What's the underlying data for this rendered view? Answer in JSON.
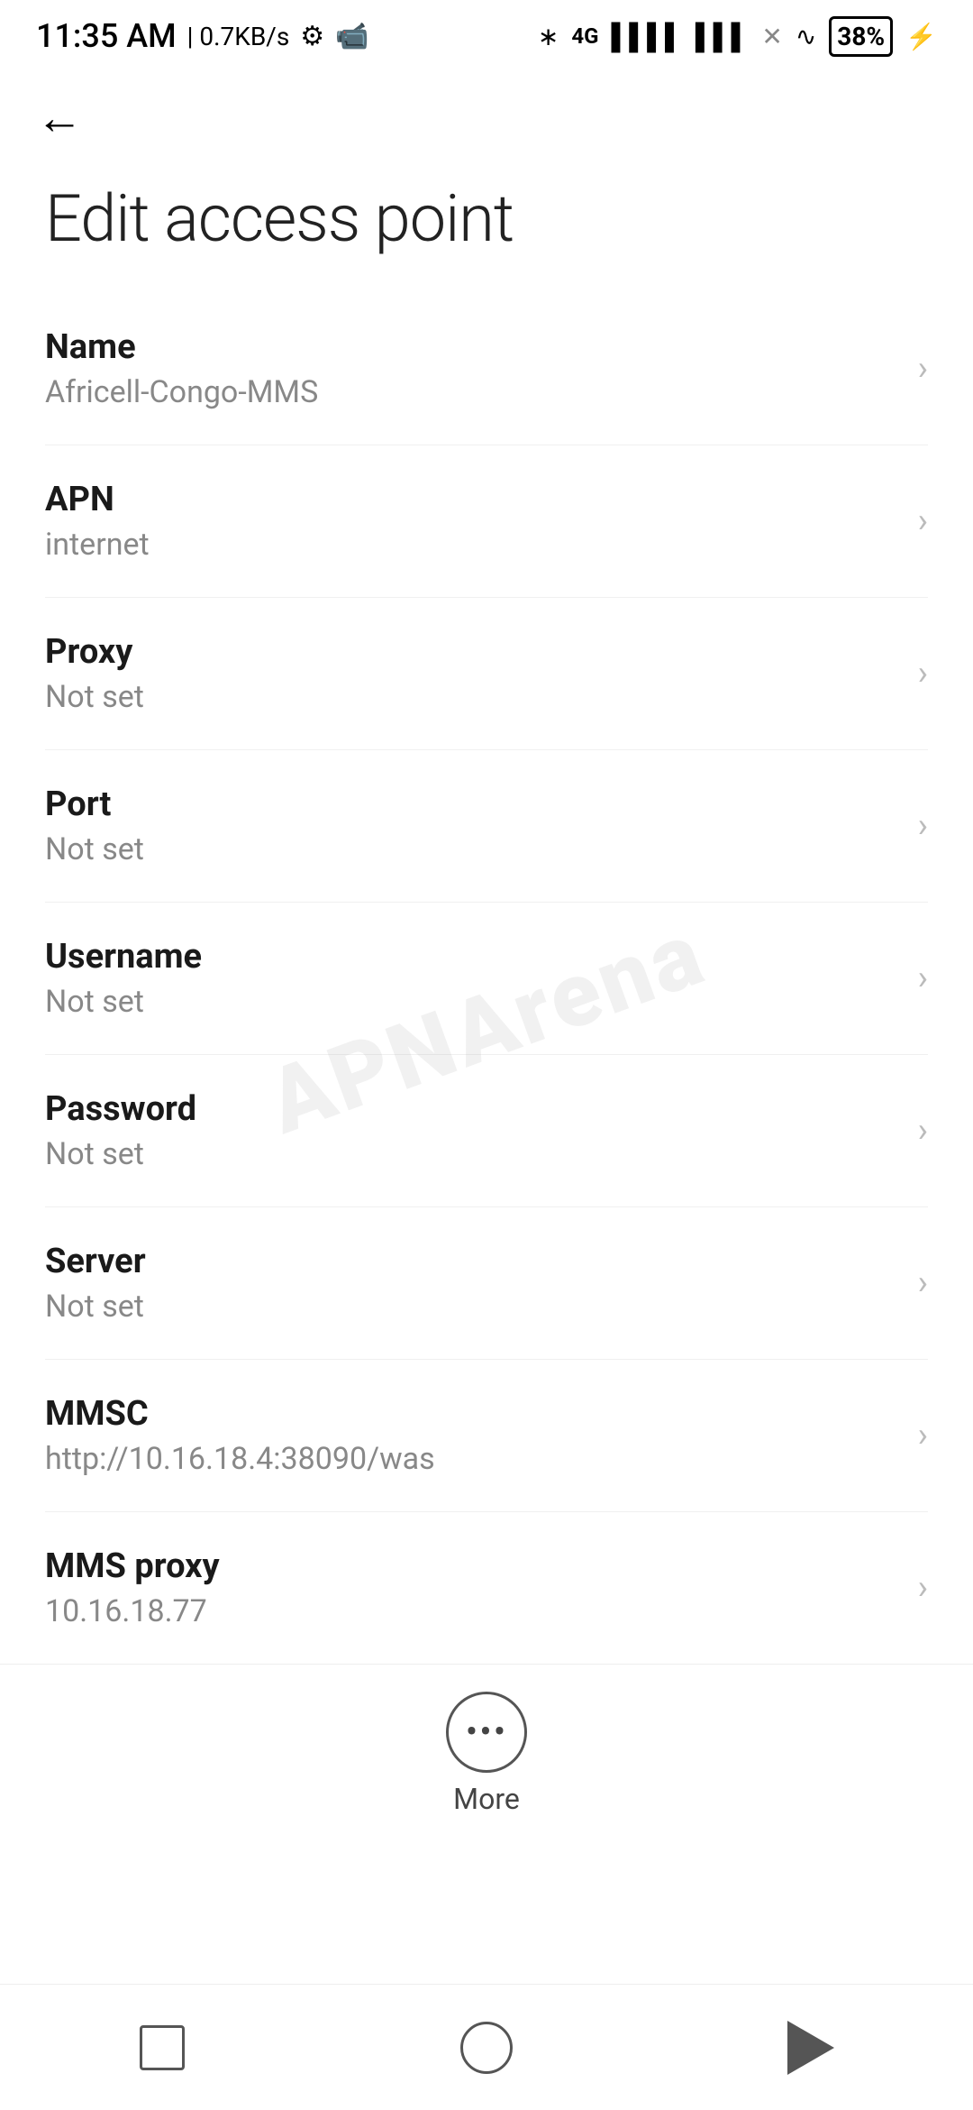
{
  "statusBar": {
    "time": "11:35 AM",
    "speed": "| 0.7KB/s",
    "battery": "38"
  },
  "header": {
    "backLabel": "←",
    "title": "Edit access point"
  },
  "settings": [
    {
      "label": "Name",
      "value": "Africell-Congo-MMS"
    },
    {
      "label": "APN",
      "value": "internet"
    },
    {
      "label": "Proxy",
      "value": "Not set"
    },
    {
      "label": "Port",
      "value": "Not set"
    },
    {
      "label": "Username",
      "value": "Not set"
    },
    {
      "label": "Password",
      "value": "Not set"
    },
    {
      "label": "Server",
      "value": "Not set"
    },
    {
      "label": "MMSC",
      "value": "http://10.16.18.4:38090/was"
    },
    {
      "label": "MMS proxy",
      "value": "10.16.18.77"
    }
  ],
  "more": {
    "label": "More"
  },
  "watermark": "APNArena"
}
